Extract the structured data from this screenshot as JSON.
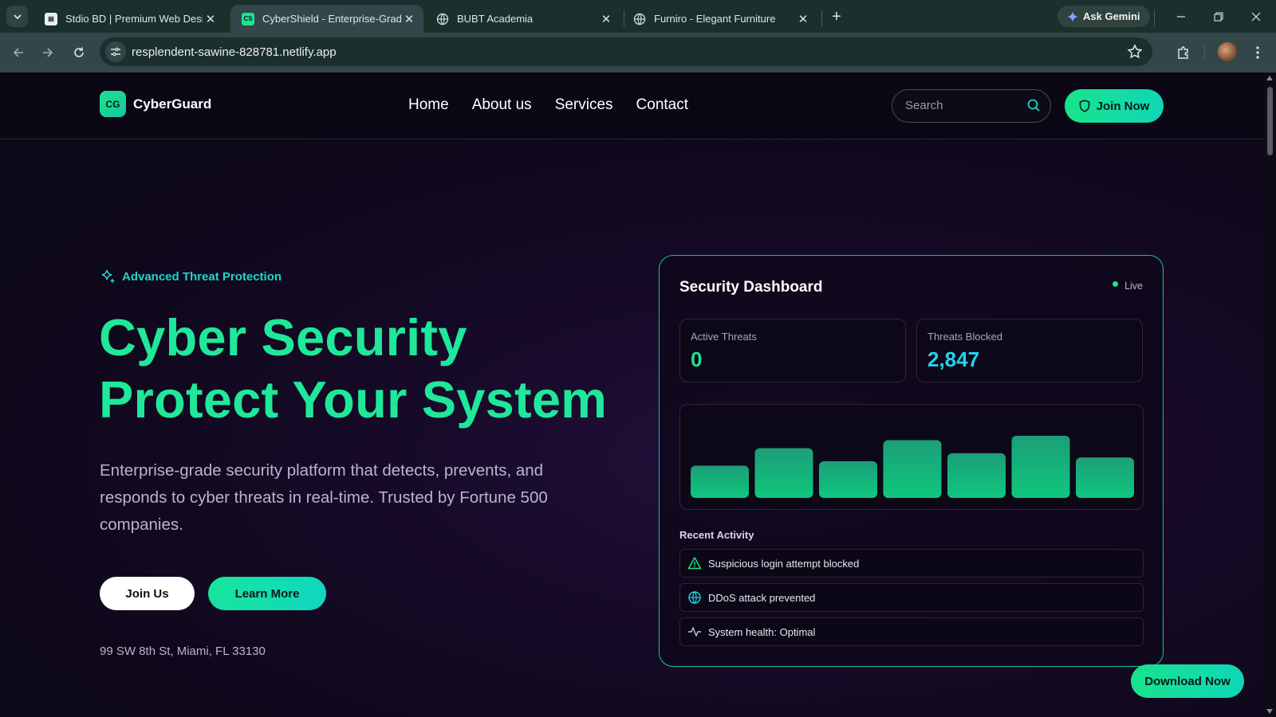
{
  "browser": {
    "tabs": [
      {
        "title": "Stdio BD | Premium Web Design",
        "active": false
      },
      {
        "title": "CyberShield - Enterprise-Grade",
        "active": true
      },
      {
        "title": "BUBT Academia",
        "active": false
      },
      {
        "title": "Furniro - Elegant Furniture",
        "active": false
      }
    ],
    "active_tab_favicon": "CS",
    "gemini_label": "Ask Gemini",
    "url": "resplendent-sawine-828781.netlify.app"
  },
  "site": {
    "logo_badge": "CG",
    "brand": "CyberGuard",
    "nav": [
      "Home",
      "About us",
      "Services",
      "Contact"
    ],
    "search_placeholder": "Search",
    "join_now": "Join Now"
  },
  "hero": {
    "badge": "Advanced Threat Protection",
    "title_line1": "Cyber Security",
    "title_line2": "Protect Your System",
    "description": "Enterprise-grade security platform that detects, prevents, and responds to cyber threats in real-time. Trusted by Fortune 500 companies.",
    "join_us": "Join Us",
    "learn_more": "Learn More",
    "address": "99 SW 8th St, Miami, FL 33130"
  },
  "dashboard": {
    "title": "Security Dashboard",
    "live": "Live",
    "stats": [
      {
        "label": "Active Threats",
        "value": "0",
        "color": "#1fe28f"
      },
      {
        "label": "Threats Blocked",
        "value": "2,847",
        "color": "#22d3ee"
      }
    ],
    "bars": [
      0.52,
      0.8,
      0.59,
      0.93,
      0.72,
      1.0,
      0.65
    ],
    "recent_title": "Recent Activity",
    "activity": [
      {
        "icon": "warning-icon",
        "text": "Suspicious login attempt blocked"
      },
      {
        "icon": "globe-icon",
        "text": "DDoS attack prevented"
      },
      {
        "icon": "activity-icon",
        "text": "System health: Optimal"
      }
    ]
  },
  "download_now": "Download Now",
  "colors": {
    "accent": "#1fe89a",
    "accent_cyan": "#22d3c5"
  }
}
